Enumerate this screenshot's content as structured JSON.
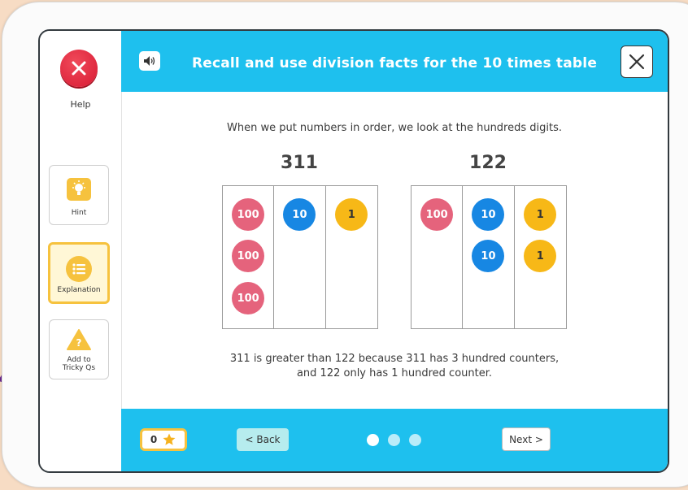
{
  "sidebar": {
    "help_label": "Help",
    "hint_label": "Hint",
    "explanation_label": "Explanation",
    "tricky_label_line1": "Add to",
    "tricky_label_line2": "Tricky Qs"
  },
  "header": {
    "title": "Recall and use division facts for the 10 times table"
  },
  "content": {
    "intro": "When we put numbers in order, we look at the hundreds digits.",
    "left_number": "311",
    "right_number": "122",
    "left_table": {
      "hundreds": [
        "100",
        "100",
        "100"
      ],
      "tens": [
        "10"
      ],
      "ones": [
        "1"
      ]
    },
    "right_table": {
      "hundreds": [
        "100"
      ],
      "tens": [
        "10",
        "10"
      ],
      "ones": [
        "1",
        "1"
      ]
    },
    "explanation_line1": "311 is greater than 122 because 311 has 3 hundred counters,",
    "explanation_line2": "and 122 only has 1 hundred counter."
  },
  "footer": {
    "star_count": "0",
    "back_label": "< Back",
    "next_label": "Next >",
    "progress_dots": {
      "total": 3,
      "current": 1
    }
  },
  "colors": {
    "header": "#1ec0ee",
    "hundred": "#e5637c",
    "ten": "#1787e3",
    "one": "#f7b817",
    "accent": "#f6c23e",
    "help_red": "#d81a33",
    "background": "#f7dcc4"
  },
  "icons": {
    "help": "close-x-icon",
    "speaker": "speaker-icon",
    "hint": "lightbulb-icon",
    "explanation": "list-icon",
    "tricky": "warning-triangle-icon",
    "star": "star-icon",
    "close": "close-icon"
  }
}
